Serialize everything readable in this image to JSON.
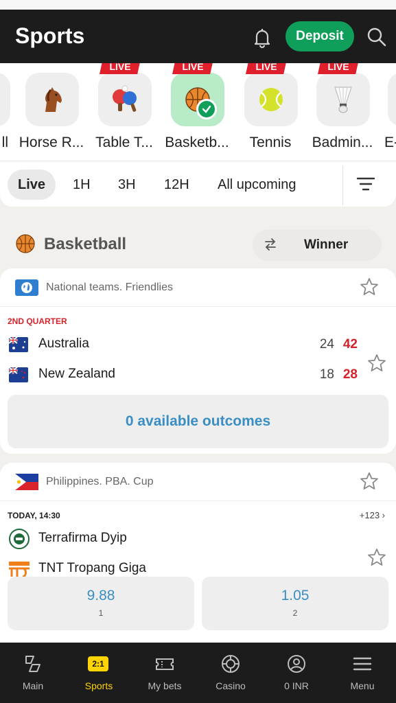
{
  "header": {
    "title": "Sports",
    "deposit_label": "Deposit"
  },
  "sports": [
    {
      "label": "ll",
      "live": false,
      "icon": "ball-icon"
    },
    {
      "label": "Horse R...",
      "live": false,
      "icon": "horse-icon"
    },
    {
      "label": "Table T...",
      "live": true,
      "live_label": "LIVE",
      "icon": "table-tennis-icon"
    },
    {
      "label": "Basketb...",
      "live": true,
      "live_label": "LIVE",
      "icon": "basketball-icon",
      "selected": true
    },
    {
      "label": "Tennis",
      "live": true,
      "live_label": "LIVE",
      "icon": "tennis-icon"
    },
    {
      "label": "Badmin...",
      "live": true,
      "live_label": "LIVE",
      "icon": "badminton-icon"
    },
    {
      "label": "E-",
      "live": false,
      "icon": "esports-icon"
    }
  ],
  "time_filters": {
    "live": "Live",
    "h1": "1H",
    "h3": "3H",
    "h12": "12H",
    "upcoming": "All upcoming"
  },
  "section": {
    "name": "Basketball",
    "market": "Winner"
  },
  "match1": {
    "league": "National teams. Friendlies",
    "status": "2ND QUARTER",
    "team1": {
      "name": "Australia",
      "score_total": "24",
      "score_period": "42"
    },
    "team2": {
      "name": "New Zealand",
      "score_total": "18",
      "score_period": "28"
    },
    "outcomes": "0 available outcomes"
  },
  "match2": {
    "league": "Philippines. PBA. Cup",
    "time": "TODAY, 14:30",
    "more": "+123 ›",
    "team1": {
      "name": "Terrafirma Dyip"
    },
    "team2": {
      "name": "TNT Tropang Giga"
    },
    "odd1": {
      "value": "9.88",
      "key": "1"
    },
    "odd2": {
      "value": "1.05",
      "key": "2"
    }
  },
  "bottom_nav": {
    "main": "Main",
    "sports": "Sports",
    "sports_badge": "2:1",
    "mybets": "My bets",
    "casino": "Casino",
    "balance": "0 INR",
    "menu": "Menu"
  },
  "colors": {
    "accent_green": "#0f9f5b",
    "live_red": "#e01f2d",
    "odd_blue": "#3b8ec3",
    "nav_active": "#ffd400"
  }
}
